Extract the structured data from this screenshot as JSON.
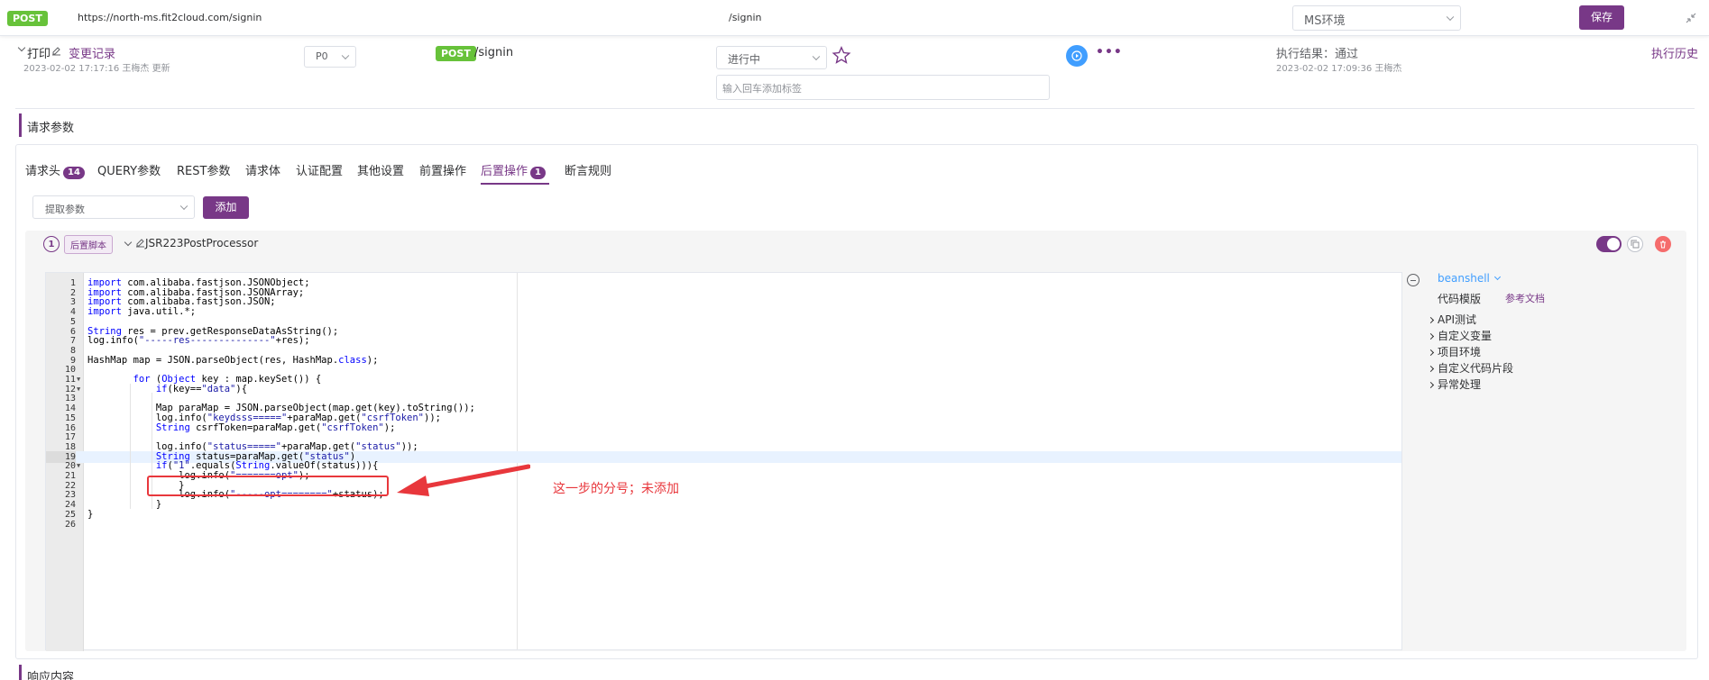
{
  "url_bar": {
    "method": "POST",
    "url": "https://north-ms.fit2cloud.com/signin",
    "path": "/signin",
    "environment": "MS环境",
    "save_label": "保存"
  },
  "case_header": {
    "name": "打印",
    "change_record": "变更记录",
    "updated_info": "2023-02-02 17:17:16 王梅杰 更新",
    "priority": "P0",
    "method": "POST",
    "path": "/signin",
    "status": "进行中",
    "tag_placeholder": "输入回车添加标签",
    "exec_result": "执行结果：通过",
    "exec_time": "2023-02-02 17:09:36 王梅杰",
    "exec_history": "执行历史"
  },
  "request_params": {
    "title": "请求参数",
    "tabs": [
      {
        "label": "请求头",
        "badge": "14"
      },
      {
        "label": "QUERY参数",
        "badge": ""
      },
      {
        "label": "REST参数",
        "badge": ""
      },
      {
        "label": "请求体",
        "badge": ""
      },
      {
        "label": "认证配置",
        "badge": ""
      },
      {
        "label": "其他设置",
        "badge": ""
      },
      {
        "label": "前置操作",
        "badge": ""
      },
      {
        "label": "后置操作",
        "badge": "1"
      },
      {
        "label": "断言规则",
        "badge": ""
      }
    ],
    "active_tab": "后置操作",
    "extract_placeholder": "提取参数",
    "add_label": "添加"
  },
  "processor": {
    "index": "1",
    "type_tag": "后置脚本",
    "name": "JSR223PostProcessor",
    "enabled": true
  },
  "code_lines": [
    "import com.alibaba.fastjson.JSONObject;",
    "import com.alibaba.fastjson.JSONArray;",
    "import com.alibaba.fastjson.JSON;",
    "import java.util.*;",
    "",
    "String res = prev.getResponseDataAsString();",
    "log.info(\"-----res--------------\"+res);",
    "",
    "HashMap map = JSON.parseObject(res, HashMap.class);",
    "",
    "        for (Object key : map.keySet()) {",
    "            if(key==\"data\"){",
    "",
    "            Map paraMap = JSON.parseObject(map.get(key).toString());",
    "            log.info(\"keydsss=====\"+paraMap.get(\"csrfToken\"));",
    "            String csrfToken=paraMap.get(\"csrfToken\");",
    "",
    "            log.info(\"status=====\"+paraMap.get(\"status\"));",
    "            String status=paraMap.get(\"status\")",
    "            if(\"1\".equals(String.valueOf(status))){",
    "                log.info(\"=======opt\");",
    "                }",
    "                log.info(\"-----opt========\"+status);",
    "            }",
    "}",
    ""
  ],
  "foldable_lines": [
    11,
    12,
    20
  ],
  "highlighted_line": 19,
  "annotation": "这一步的分号；未添加",
  "script_panel": {
    "language": "beanshell",
    "code_template": "代码模版",
    "ref_doc": "参考文档",
    "items": [
      "API测试",
      "自定义变量",
      "项目环境",
      "自定义代码片段",
      "异常处理"
    ]
  },
  "response_section": {
    "title": "响应内容"
  },
  "colors": {
    "brand": "#783887",
    "post_green": "#67c23a",
    "annotation_red": "#e8373c"
  }
}
